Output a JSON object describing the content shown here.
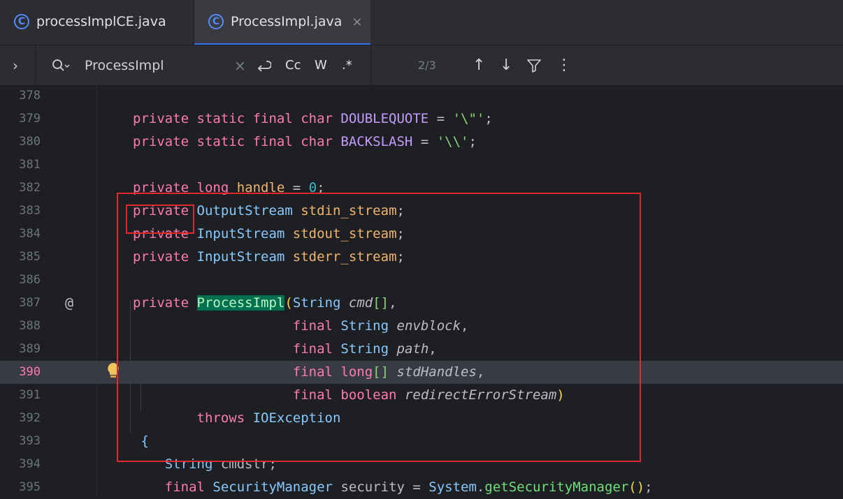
{
  "tabs": [
    {
      "icon": "class-icon",
      "icon_letter": "C",
      "label": "processImplCE.java",
      "active": false
    },
    {
      "icon": "class-icon",
      "icon_letter": "C",
      "label": "ProcessImpl.java",
      "active": true,
      "close": "×"
    }
  ],
  "search": {
    "expand": "›",
    "query": "ProcessImpl",
    "clear": "×",
    "opt_case": "Cc",
    "opt_word": "W",
    "opt_regex": ".*",
    "count": "2/3",
    "prev": "↑",
    "next": "↓",
    "more": "⋮"
  },
  "gutter": {
    "annotation": "@"
  },
  "lines": [
    {
      "n": "378",
      "html": ""
    },
    {
      "n": "379",
      "html": "<span class=\"kw\">private static final char </span><span class=\"const\">DOUBLEQUOTE</span> = <span class=\"str\">'\\\"'</span>;"
    },
    {
      "n": "380",
      "html": "<span class=\"kw\">private static final char </span><span class=\"const\">BACKSLASH</span> = <span class=\"str\">'\\\\'</span>;"
    },
    {
      "n": "381",
      "html": ""
    },
    {
      "n": "382",
      "html": "<span class=\"kw\">private long </span><span class=\"fld\">handle</span> = <span class=\"num\">0</span>;"
    },
    {
      "n": "383",
      "html": "<span class=\"kw\">private </span><span class=\"ty\">OutputStream </span><span class=\"fld\">stdin_stream</span>;"
    },
    {
      "n": "384",
      "html": "<span class=\"kw\">private </span><span class=\"ty\">InputStream </span><span class=\"fld\">stdout_stream</span>;"
    },
    {
      "n": "385",
      "html": "<span class=\"kw\">private </span><span class=\"ty\">InputStream </span><span class=\"fld\">stderr_stream</span>;"
    },
    {
      "n": "386",
      "html": ""
    },
    {
      "n": "387",
      "html": "<span class=\"kw\">private </span><span class=\"hl\">ProcessImpl</span><span class=\"brk\">(</span><span class=\"ty\">String </span><span class=\"prm\">cmd</span><span class=\"str\">[]</span>,"
    },
    {
      "n": "388",
      "html": "                    <span class=\"kw\">final </span><span class=\"ty\">String </span><span class=\"prm\">envblock</span>,"
    },
    {
      "n": "389",
      "html": "                    <span class=\"kw\">final </span><span class=\"ty\">String </span><span class=\"prm\">path</span>,"
    },
    {
      "n": "390",
      "html": "                    <span class=\"kw\">final long</span><span class=\"str\">[]</span> <span class=\"prm\">stdHandles</span>,",
      "current": true
    },
    {
      "n": "391",
      "html": "                    <span class=\"kw\">final boolean </span><span class=\"prm\">redirectErrorStream</span><span class=\"brk\">)</span>"
    },
    {
      "n": "392",
      "html": "        <span class=\"kw\">throws </span><span class=\"ty\">IOException</span>"
    },
    {
      "n": "393",
      "html": " <span class=\"ty\">{</span>"
    },
    {
      "n": "394",
      "html": "    <span class=\"ty\">String </span>cmdstr;"
    },
    {
      "n": "395",
      "html": "    <span class=\"kw\">final </span><span class=\"ty\">SecurityManager </span>security = <span class=\"glob\">System</span>.<span class=\"meth\">getSecurityManager</span><span class=\"brk\">()</span>;"
    }
  ]
}
